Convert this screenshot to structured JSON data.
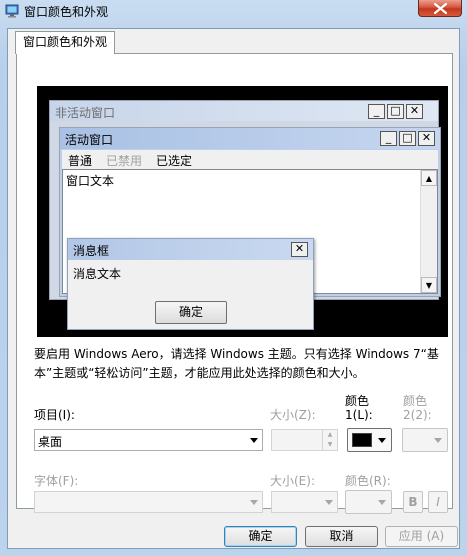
{
  "window": {
    "title": "窗口颜色和外观",
    "close_symbol": "✕"
  },
  "tab": {
    "label": "窗口颜色和外观"
  },
  "preview": {
    "inactive_title": "非活动窗口",
    "active_title": "活动窗口",
    "caption_buttons": {
      "minimize": "_",
      "maximize": "□",
      "close": "✕"
    },
    "menu": [
      "普通",
      "已禁用",
      "已选定"
    ],
    "window_text": "窗口文本",
    "msgbox_title": "消息框",
    "msgbox_text": "消息文本",
    "msgbox_ok": "确定",
    "scroll_up": "▲",
    "scroll_down": "▼"
  },
  "info_text": "要启用 Windows Aero，请选择 Windows 主题。只有选择 Windows 7“基本”主题或“轻松访问”主题，才能应用此处选择的颜色和大小。",
  "form": {
    "item_label": "项目(I):",
    "item_value": "桌面",
    "size1_label": "大小(Z):",
    "color1_label_top": "颜色",
    "color1_label_bottom": "1(L):",
    "color2_label_top": "颜色",
    "color2_label_bottom": "2(2):",
    "color1_value": "#000000",
    "font_label": "字体(F):",
    "size2_label": "大小(E):",
    "fontcolor_label": "颜色(R):",
    "bold": "B",
    "italic": "I"
  },
  "buttons": {
    "ok": "确定",
    "cancel": "取消",
    "apply": "应用 (A)"
  }
}
